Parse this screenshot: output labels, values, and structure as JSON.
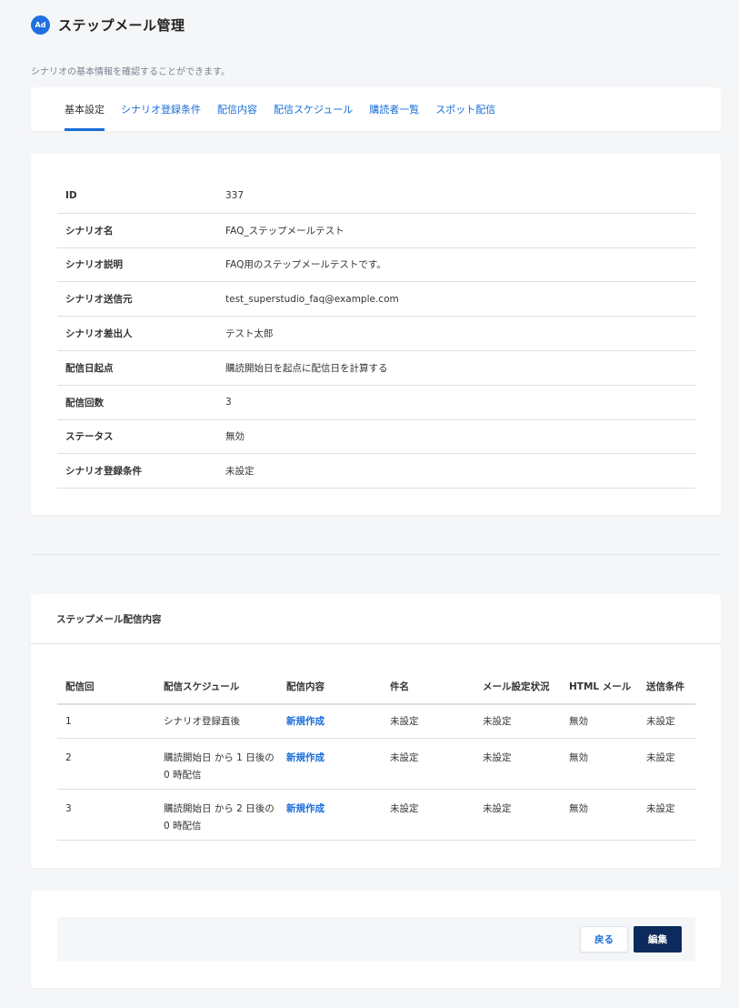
{
  "header": {
    "logo_text": "Ad",
    "title": "ステップメール管理"
  },
  "subtitle": "シナリオの基本情報を確認することができます。",
  "tabs": [
    {
      "label": "基本設定",
      "active": true
    },
    {
      "label": "シナリオ登録条件",
      "active": false
    },
    {
      "label": "配信内容",
      "active": false
    },
    {
      "label": "配信スケジュール",
      "active": false
    },
    {
      "label": "購読者一覧",
      "active": false
    },
    {
      "label": "スポット配信",
      "active": false
    }
  ],
  "info": [
    {
      "label": "ID",
      "value": "337"
    },
    {
      "label": "シナリオ名",
      "value": "FAQ_ステップメールテスト"
    },
    {
      "label": "シナリオ説明",
      "value": "FAQ用のステップメールテストです。"
    },
    {
      "label": "シナリオ送信元",
      "value": "test_superstudio_faq@example.com"
    },
    {
      "label": "シナリオ差出人",
      "value": "テスト太郎"
    },
    {
      "label": "配信日起点",
      "value": "購読開始日を起点に配信日を計算する"
    },
    {
      "label": "配信回数",
      "value": "3"
    },
    {
      "label": "ステータス",
      "value": "無効"
    },
    {
      "label": "シナリオ登録条件",
      "value": "未設定"
    }
  ],
  "step_section": {
    "title": "ステップメール配信内容",
    "columns": [
      "配信回",
      "配信スケジュール",
      "配信内容",
      "件名",
      "メール設定状況",
      "HTML メール",
      "送信条件"
    ],
    "rows": [
      {
        "num": "1",
        "schedule": "シナリオ登録直後",
        "content": "新規作成",
        "subject": "未設定",
        "mail_status": "未設定",
        "html": "無効",
        "condition": "未設定"
      },
      {
        "num": "2",
        "schedule": "購読開始日 から 1 日後の 0 時配信",
        "content": "新規作成",
        "subject": "未設定",
        "mail_status": "未設定",
        "html": "無効",
        "condition": "未設定"
      },
      {
        "num": "3",
        "schedule": "購読開始日 から 2 日後の 0 時配信",
        "content": "新規作成",
        "subject": "未設定",
        "mail_status": "未設定",
        "html": "無効",
        "condition": "未設定"
      }
    ]
  },
  "actions": {
    "back_label": "戻る",
    "edit_label": "編集"
  },
  "colors": {
    "accent": "#1a6dd8",
    "primary_button": "#0d2a5c",
    "background": "#f5f6f8"
  }
}
